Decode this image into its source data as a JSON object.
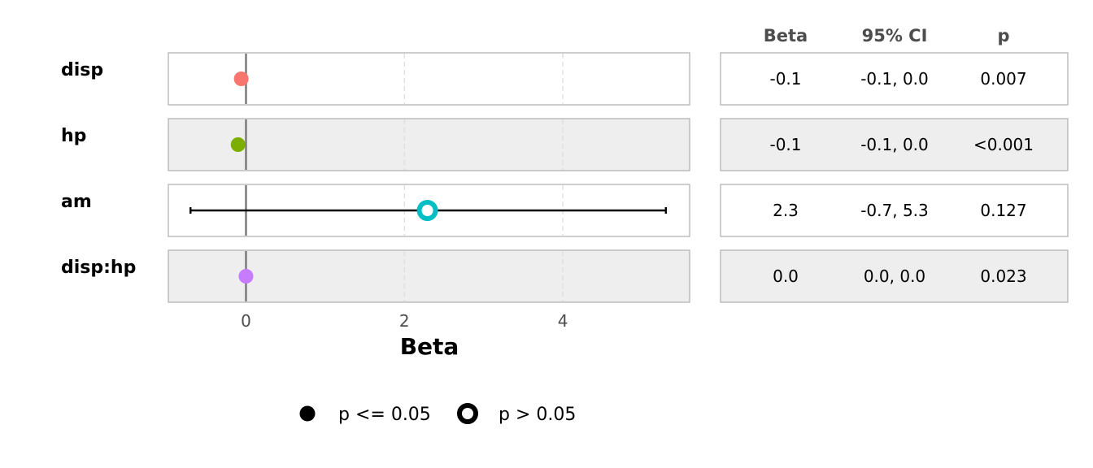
{
  "chart_data": {
    "type": "forest",
    "xlabel": "Beta",
    "x_ticks": [
      0,
      2,
      4
    ],
    "xlim": [
      -0.98,
      5.6
    ],
    "zero_line": 0,
    "rows": [
      {
        "term": "disp",
        "estimate": -0.06,
        "ci_low": null,
        "ci_high": null,
        "color": "#F8766D",
        "significant": true,
        "beta_text": "-0.1",
        "ci_text": "-0.1, 0.0",
        "p_text": "0.007",
        "shaded": false
      },
      {
        "term": "hp",
        "estimate": -0.1,
        "ci_low": null,
        "ci_high": null,
        "color": "#7CAE00",
        "significant": true,
        "beta_text": "-0.1",
        "ci_text": "-0.1, 0.0",
        "p_text": "<0.001",
        "shaded": true
      },
      {
        "term": "am",
        "estimate": 2.29,
        "ci_low": -0.7,
        "ci_high": 5.3,
        "color": "#00BFC4",
        "significant": false,
        "beta_text": "2.3",
        "ci_text": "-0.7, 5.3",
        "p_text": "0.127",
        "shaded": false
      },
      {
        "term": "disp:hp",
        "estimate": 0.0,
        "ci_low": null,
        "ci_high": null,
        "color": "#C77CFF",
        "significant": true,
        "beta_text": "0.0",
        "ci_text": "0.0, 0.0",
        "p_text": "0.023",
        "shaded": true
      }
    ],
    "table_headers": [
      "Beta",
      "95% CI",
      "p"
    ],
    "legend": [
      "p <= 0.05",
      "p > 0.05"
    ]
  }
}
